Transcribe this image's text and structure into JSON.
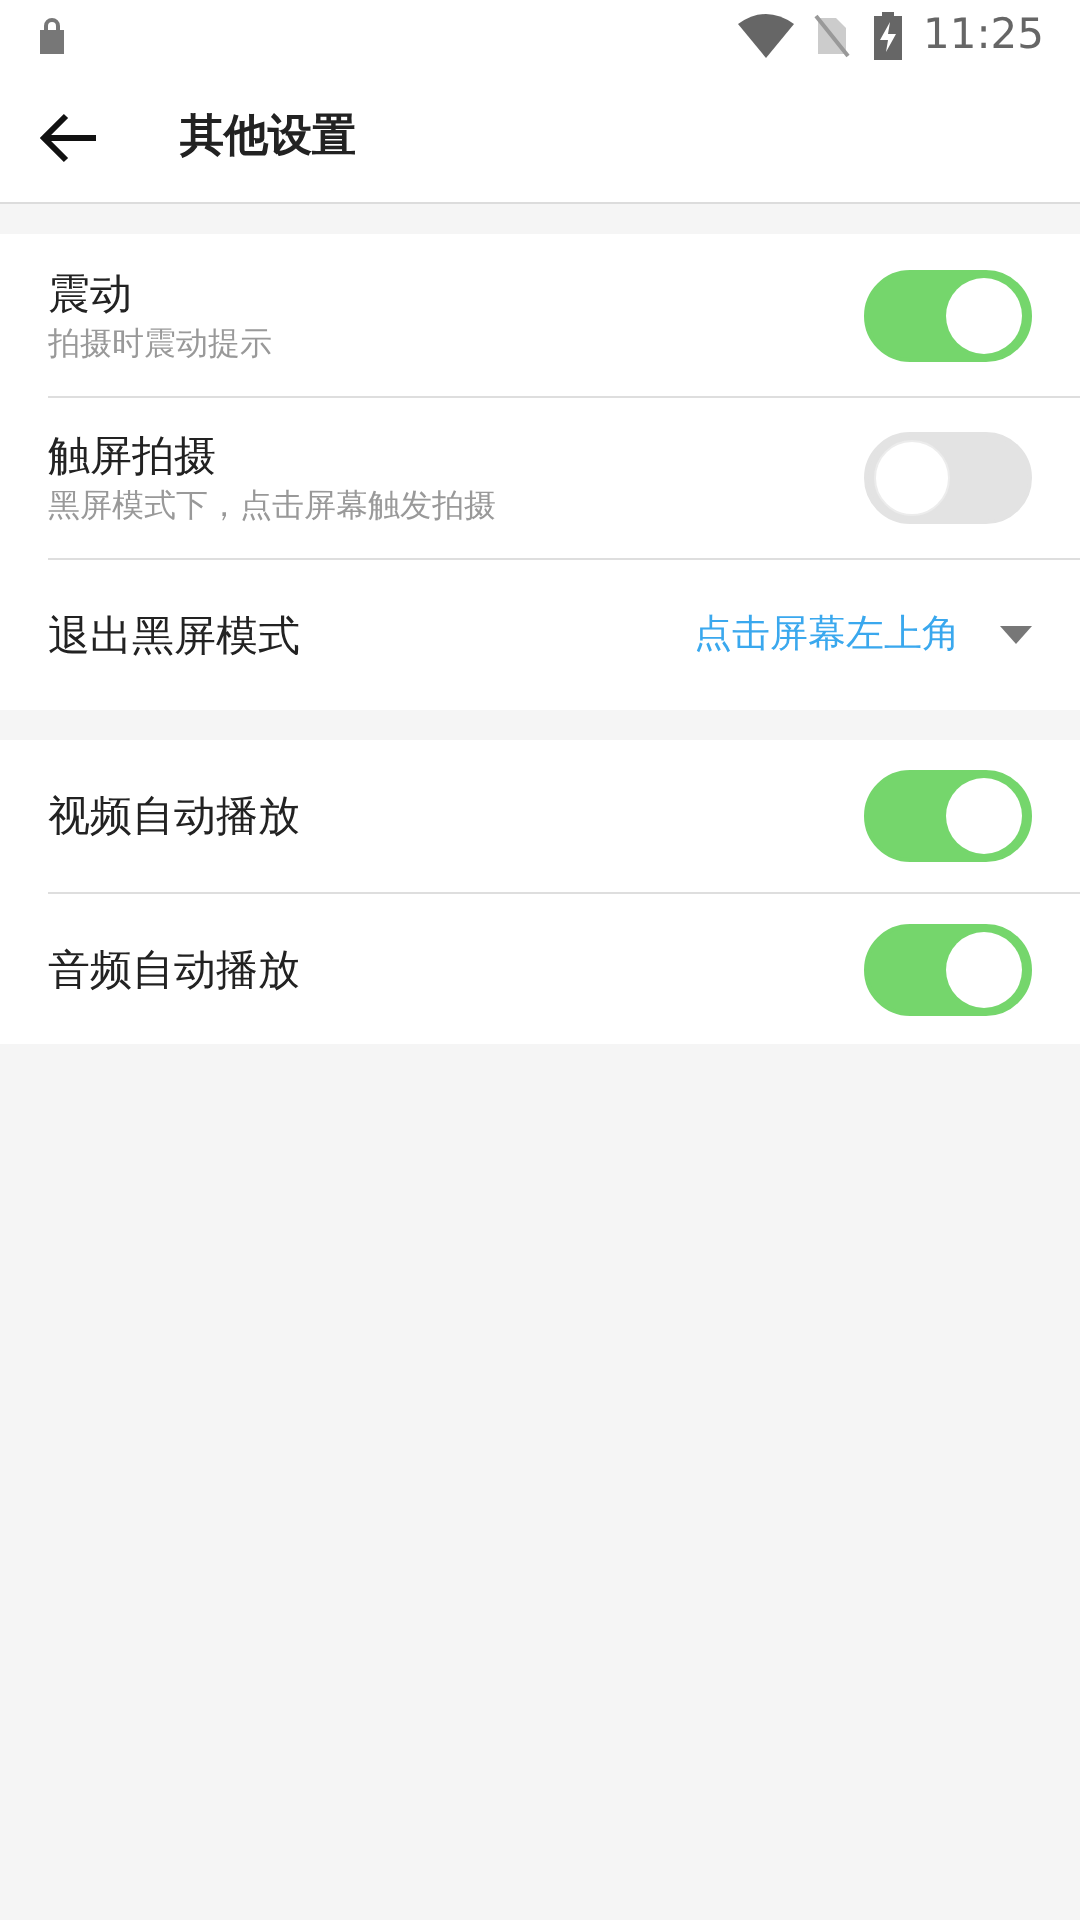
{
  "status_bar": {
    "time": "11:25"
  },
  "header": {
    "title": "其他设置"
  },
  "sections": [
    {
      "rows": [
        {
          "kind": "toggle",
          "label": "震动",
          "subtitle": "拍摄时震动提示",
          "on": true
        },
        {
          "kind": "toggle",
          "label": "触屏拍摄",
          "subtitle": "黑屏模式下，点击屏幕触发拍摄",
          "on": false
        },
        {
          "kind": "select",
          "label": "退出黑屏模式",
          "value": "点击屏幕左上角"
        }
      ]
    },
    {
      "rows": [
        {
          "kind": "toggle",
          "label": "视频自动播放",
          "on": true
        },
        {
          "kind": "toggle",
          "label": "音频自动播放",
          "on": true
        }
      ]
    }
  ]
}
